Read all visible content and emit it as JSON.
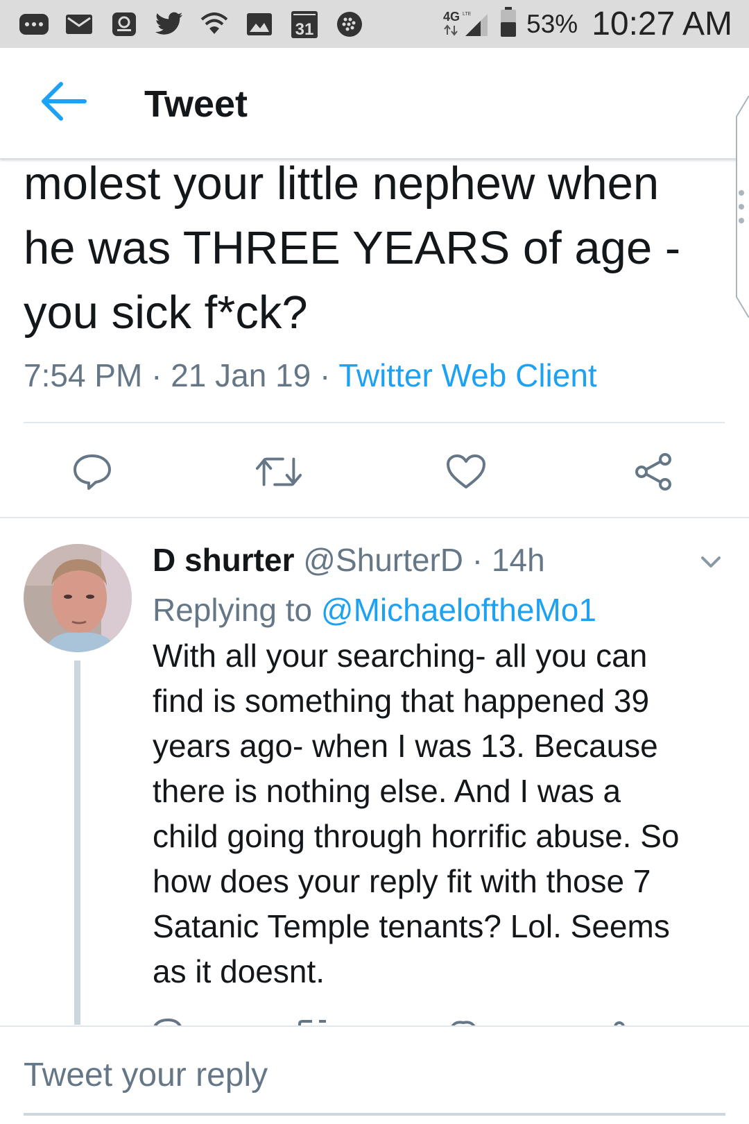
{
  "status_bar": {
    "icons": [
      "more-icon",
      "mail-icon",
      "voicemail-icon",
      "twitter-icon",
      "wifi-icon",
      "image-icon",
      "calendar-icon",
      "blackberry-icon"
    ],
    "calendar_day": "31",
    "network": "4G LTE",
    "battery_percent": "53%",
    "battery_level": 0.53,
    "time": "10:27 AM"
  },
  "header": {
    "title": "Tweet"
  },
  "main_tweet": {
    "text_lines": [
      "molest your little nephew when",
      "he was THREE YEARS of age -",
      "you sick f*ck?"
    ],
    "time": "7:54 PM",
    "date": "21 Jan 19",
    "separator": " · ",
    "client": "Twitter Web Client"
  },
  "reply": {
    "display_name": "D shurter",
    "handle": "@ShurterD",
    "age": "14h",
    "replying_label": "Replying to",
    "replying_to": "@MichaeloftheMo1",
    "text": "With all your searching- all you can\nfind is something that happened 39\nyears ago- when I was 13. Because\nthere is nothing else. And I was a\nchild going through horrific abuse. So\nhow does your reply fit with those 7\nSatanic Temple tenants? Lol. Seems\nas it doesnt."
  },
  "composer": {
    "placeholder": "Tweet your reply"
  },
  "colors": {
    "accent": "#1da1f2",
    "text": "#14171a",
    "muted": "#657786",
    "icon": "#657786"
  }
}
